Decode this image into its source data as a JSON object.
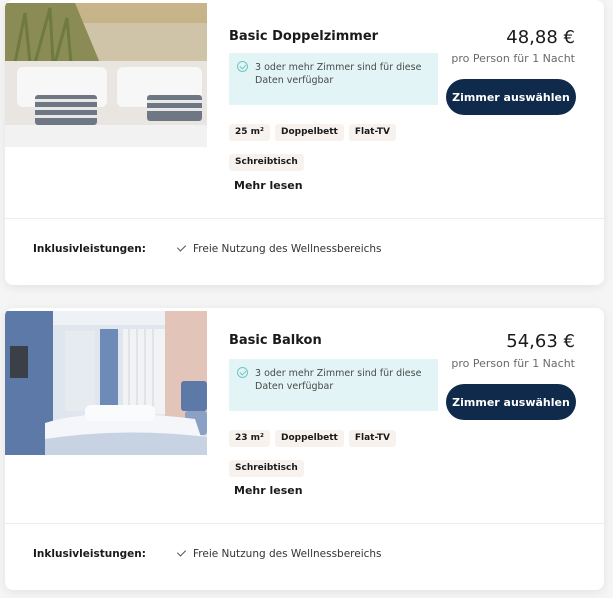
{
  "rooms": [
    {
      "title": "Basic Doppelzimmer",
      "availability": "3 oder mehr Zimmer sind für diese Daten verfügbar",
      "tags": [
        "25 m²",
        "Doppelbett",
        "Flat-TV",
        "Schreibtisch"
      ],
      "more_label": "Mehr lesen",
      "price": "48,88 €",
      "price_note": "pro Person für 1 Nacht",
      "select_label": "Zimmer auswählen",
      "inclusions_label": "Inklusivleistungen:",
      "inclusion": "Freie Nutzung des Wellnessbereichs"
    },
    {
      "title": "Basic Balkon",
      "availability": "3 oder mehr Zimmer sind für diese Daten verfügbar",
      "tags": [
        "23 m²",
        "Doppelbett",
        "Flat-TV",
        "Schreibtisch"
      ],
      "more_label": "Mehr lesen",
      "price": "54,63 €",
      "price_note": "pro Person für 1 Nacht",
      "select_label": "Zimmer auswählen",
      "inclusions_label": "Inklusivleistungen:",
      "inclusion": "Freie Nutzung des Wellnessbereichs"
    }
  ],
  "icons": {
    "availability": "check-circle-icon",
    "inclusion": "checkmark-icon"
  }
}
